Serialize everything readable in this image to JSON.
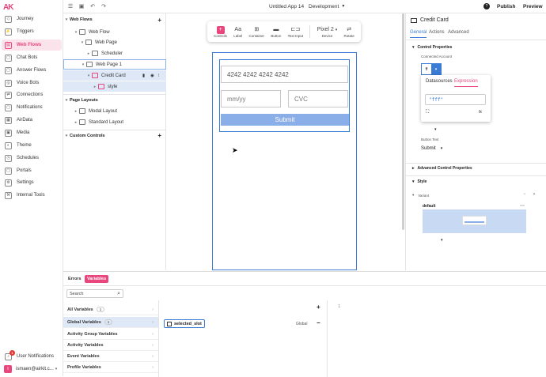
{
  "nav": {
    "logo": "AK",
    "items": [
      {
        "label": "Journey",
        "icon": "journey-icon"
      },
      {
        "label": "Triggers",
        "icon": "triggers-icon"
      },
      {
        "label": "Web Flows",
        "icon": "web-flows-icon"
      },
      {
        "label": "Chat Bots",
        "icon": "chat-bots-icon"
      },
      {
        "label": "Answer Flows",
        "icon": "answer-flows-icon"
      },
      {
        "label": "Voice Bots",
        "icon": "voice-bots-icon"
      },
      {
        "label": "Connections",
        "icon": "connections-icon"
      },
      {
        "label": "Notifications",
        "icon": "notifications-icon"
      },
      {
        "label": "AirData",
        "icon": "airdata-icon"
      },
      {
        "label": "Media",
        "icon": "media-icon"
      },
      {
        "label": "Theme",
        "icon": "theme-icon"
      },
      {
        "label": "Schedules",
        "icon": "schedules-icon"
      },
      {
        "label": "Portals",
        "icon": "portals-icon"
      },
      {
        "label": "Settings",
        "icon": "settings-icon"
      },
      {
        "label": "Internal Tools",
        "icon": "internal-tools-icon"
      }
    ],
    "active_index": 2,
    "user_notifications": "User Notifications",
    "user_notifications_badge": "1",
    "user_email": "ismaen@airkit.c...",
    "user_avatar": "I",
    "accent": "#e8467c"
  },
  "topbar": {
    "app_title": "Untitled App 14",
    "environment": "Development",
    "publish": "Publish",
    "preview": "Preview"
  },
  "tree": {
    "web_flows_header": "Web Flows",
    "rows": [
      {
        "label": "Web Flow"
      },
      {
        "label": "Web Page"
      },
      {
        "label": "Scheduler"
      },
      {
        "label": "Web Page 1"
      },
      {
        "label": "Credit Card"
      },
      {
        "label": "style"
      }
    ],
    "page_layouts_header": "Page Layouts",
    "layouts": [
      {
        "label": "Modal Layout"
      },
      {
        "label": "Standard Layout"
      }
    ],
    "custom_controls_header": "Custom Controls"
  },
  "toolbar": {
    "controls": "Controls",
    "label": "Label",
    "container": "Container",
    "button": "Button",
    "text_input": "Text Input",
    "device_value": "Pixel 2",
    "device": "Device",
    "rotate": "Rotate"
  },
  "credit_card": {
    "card_number": "4242 4242 4242 4242",
    "expiry_placeholder": "mm/yy",
    "cvc_placeholder": "CVC",
    "submit": "Submit"
  },
  "inspector": {
    "title": "Credit Card",
    "tabs": [
      "General",
      "Actions",
      "Advanced"
    ],
    "control_properties": "Control Properties",
    "connected_account": "Connected Account",
    "popover_tabs": [
      "Datasources",
      "Expression"
    ],
    "expression_value": "\"fff\"",
    "button_text_label": "Button Text",
    "button_text_value": "Submit",
    "advanced_control_properties": "Advanced Control Properties",
    "style": "Style",
    "variant": "Variant",
    "variant_name": "default"
  },
  "bottom": {
    "tabs": [
      "Errors",
      "Variables"
    ],
    "search_placeholder": "Search",
    "categories": [
      {
        "label": "All Variables",
        "count": "1"
      },
      {
        "label": "Global Variables",
        "count": "1"
      },
      {
        "label": "Activity Group Variables",
        "count": ""
      },
      {
        "label": "Activity Variables",
        "count": ""
      },
      {
        "label": "Event Variables",
        "count": ""
      },
      {
        "label": "Profile Variables",
        "count": ""
      }
    ],
    "variable_name": "selected_slot",
    "variable_scope": "Global",
    "line_number": "1"
  }
}
